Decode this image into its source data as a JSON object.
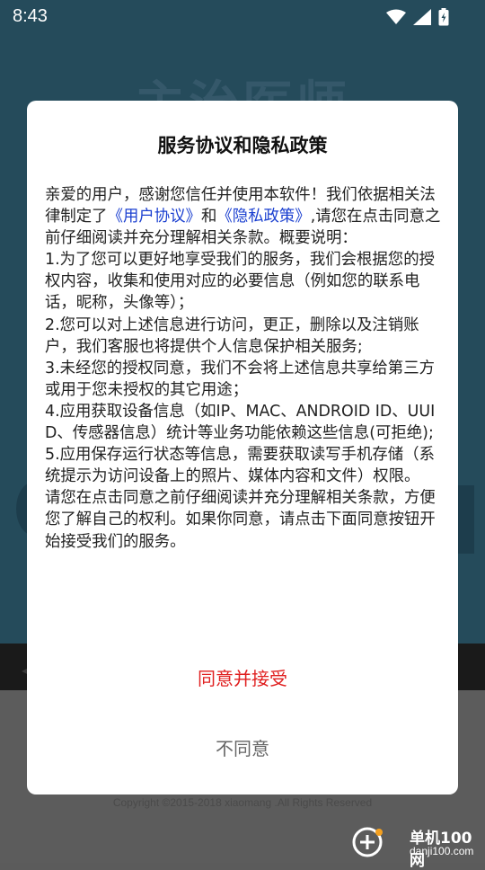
{
  "status_bar": {
    "time": "8:43",
    "icons": [
      "wifi-icon",
      "signal-icon",
      "battery-icon"
    ]
  },
  "background_app": {
    "title": "主治医师",
    "copyright": "Copyright ©2015-2018 xiaomang .All Rights Reserved"
  },
  "dialog": {
    "title": "服务协议和隐私政策",
    "intro_1": "亲爱的用户，感谢您信任并使用本软件！我们依据相关法律制定了",
    "link_user_agreement": "《用户协议》",
    "intro_and": "和",
    "link_privacy_policy": "《隐私政策》",
    "intro_2": ",请您在点击同意之前仔细阅读并充分理解相关条款。概要说明：",
    "item_1": "1.为了您可以更好地享受我们的服务，我们会根据您的授权内容，收集和使用对应的必要信息（例如您的联系电话，昵称，头像等）；",
    "item_2": "2.您可以对上述信息进行访问，更正，删除以及注销账户，我们客服也将提供个人信息保护相关服务;",
    "item_3": "3.未经您的授权同意，我们不会将上述信息共享给第三方或用于您未授权的其它用途；",
    "item_4": "4.应用获取设备信息（如IP、MAC、ANDROID ID、UUID、传感器信息）统计等业务功能依赖这些信息(可拒绝);",
    "item_5": "5.应用保存运行状态等信息，需要获取读写手机存储（系统提示为访问设备上的照片、媒体内容和文件）权限。",
    "closing": "请您在点击同意之前仔细阅读并充分理解相关条款，方便您了解自己的权利。如果你同意，请点击下面同意按钮开始接受我们的服务。",
    "agree_label": "同意并接受",
    "disagree_label": "不同意"
  },
  "watermark": {
    "name": "单机100网",
    "url": "danji100.com"
  },
  "colors": {
    "link": "#1a3fd0",
    "agree": "#e02020",
    "disagree": "#666666"
  }
}
